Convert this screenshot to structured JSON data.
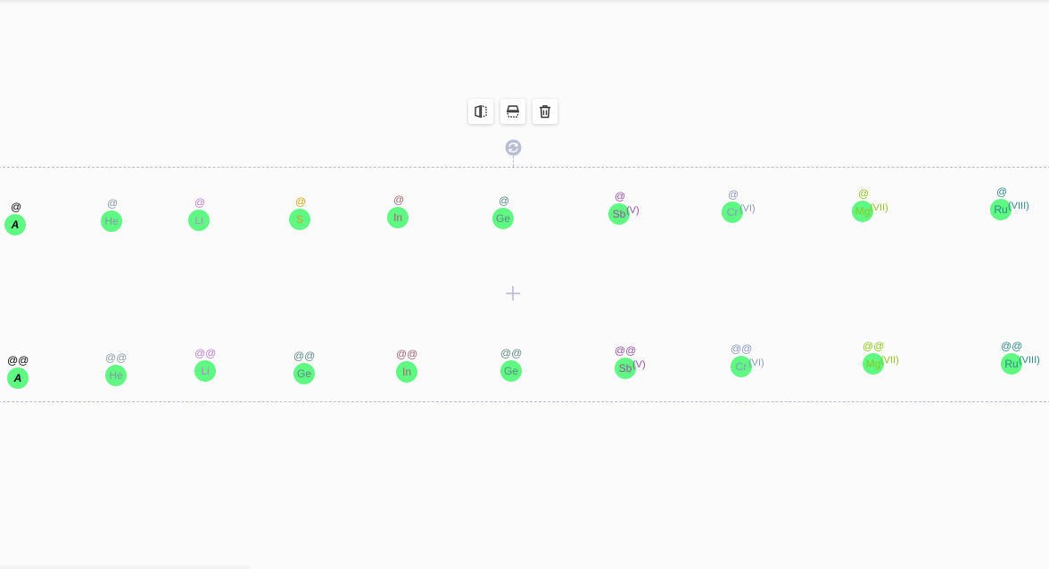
{
  "toolbar": {
    "items": [
      {
        "name": "flip-horizontal",
        "icon": "flip-horizontal-icon"
      },
      {
        "name": "flip-vertical",
        "icon": "flip-vertical-icon"
      },
      {
        "name": "delete",
        "icon": "trash-icon"
      }
    ]
  },
  "canvas": {
    "selection_color": "#b8bdd6",
    "atom_fill": "#5ff882",
    "row1": [
      {
        "symbol": "A",
        "charge": "@",
        "valence": "",
        "color": "#000000",
        "italic": true
      },
      {
        "symbol": "He",
        "charge": "@",
        "valence": "",
        "color": "#8a9aa8"
      },
      {
        "symbol": "Li",
        "charge": "@",
        "valence": "",
        "color": "#c47fd6"
      },
      {
        "symbol": "S",
        "charge": "@",
        "valence": "",
        "color": "#d6a21c"
      },
      {
        "symbol": "In",
        "charge": "@",
        "valence": "",
        "color": "#a8636e"
      },
      {
        "symbol": "Ge",
        "charge": "@",
        "valence": "",
        "color": "#5f8a8a"
      },
      {
        "symbol": "Sb",
        "charge": "@",
        "valence": "(V)",
        "color": "#9b4fa5"
      },
      {
        "symbol": "Cr",
        "charge": "@",
        "valence": "(VI)",
        "color": "#8a99c4"
      },
      {
        "symbol": "Mg",
        "charge": "@",
        "valence": "(VII)",
        "color": "#8ac81e"
      },
      {
        "symbol": "Ru",
        "charge": "@",
        "valence": "(VIII)",
        "color": "#2e8a8a"
      }
    ],
    "row2": [
      {
        "symbol": "A",
        "charge": "@@",
        "valence": "",
        "color": "#000000",
        "italic": true
      },
      {
        "symbol": "He",
        "charge": "@@",
        "valence": "",
        "color": "#8a9aa8"
      },
      {
        "symbol": "Li",
        "charge": "@@",
        "valence": "",
        "color": "#c47fd6"
      },
      {
        "symbol": "Ge",
        "charge": "@@",
        "valence": "",
        "color": "#5f8a8a"
      },
      {
        "symbol": "In",
        "charge": "@@",
        "valence": "",
        "color": "#a8636e"
      },
      {
        "symbol": "Ge",
        "charge": "@@",
        "valence": "",
        "color": "#5f8a8a"
      },
      {
        "symbol": "Sb",
        "charge": "@@",
        "valence": "(V)",
        "color": "#9b4fa5"
      },
      {
        "symbol": "Cr",
        "charge": "@@",
        "valence": "(VI)",
        "color": "#8a99c4"
      },
      {
        "symbol": "Mg",
        "charge": "@@",
        "valence": "(VII)",
        "color": "#8ac81e"
      },
      {
        "symbol": "Ru",
        "charge": "@@",
        "valence": "(VIII)",
        "color": "#2e8a8a"
      }
    ]
  }
}
